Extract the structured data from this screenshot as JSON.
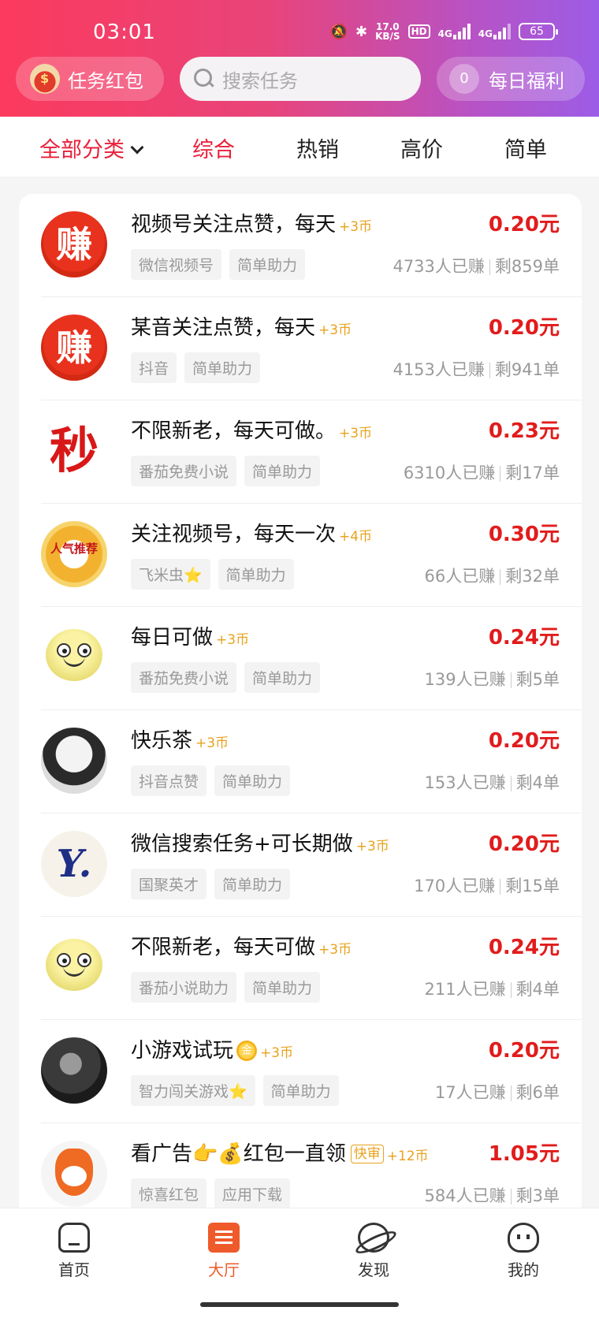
{
  "status_bar": {
    "time": "03:01",
    "net_speed_value": "17.0",
    "net_speed_unit": "KB/S",
    "hd_label": "HD",
    "sig1": "4G",
    "sig2": "4G",
    "battery": "65"
  },
  "header": {
    "redpack_label": "任务红包",
    "search_placeholder": "搜索任务",
    "daily_count": "0",
    "daily_label": "每日福利"
  },
  "filters": {
    "all_label": "全部分类",
    "tabs": [
      "综合",
      "热销",
      "高价",
      "简单"
    ],
    "active_tab": "综合"
  },
  "tasks": [
    {
      "avatar": "zhuan-icon",
      "avatar_text": "赚",
      "title": "视频号关注点赞，每天",
      "bonus": "+3币",
      "price": "0.20元",
      "tags": [
        "微信视频号",
        "简单助力"
      ],
      "earned": "4733人已赚",
      "left": "剩859单"
    },
    {
      "avatar": "zhuan-icon",
      "avatar_text": "赚",
      "title": "某音关注点赞，每天",
      "bonus": "+3币",
      "price": "0.20元",
      "tags": [
        "抖音",
        "简单助力"
      ],
      "earned": "4153人已赚",
      "left": "剩941单"
    },
    {
      "avatar": "miao-icon",
      "avatar_text": "秒",
      "title": "不限新老，每天可做。",
      "bonus": "+3币",
      "price": "0.23元",
      "tags": [
        "番茄免费小说",
        "简单助力"
      ],
      "earned": "6310人已赚",
      "left": "剩17单"
    },
    {
      "avatar": "popular-badge-icon",
      "avatar_text": "人气推荐",
      "title": "关注视频号，每天一次",
      "bonus": "+4币",
      "price": "0.30元",
      "tags": [
        "飞米虫⭐",
        "简单助力"
      ],
      "earned": "66人已赚",
      "left": "剩32单"
    },
    {
      "avatar": "smiley-icon",
      "avatar_text": "",
      "title": "每日可做",
      "bonus": "+3币",
      "price": "0.24元",
      "tags": [
        "番茄免费小说",
        "简单助力"
      ],
      "earned": "139人已赚",
      "left": "剩5单"
    },
    {
      "avatar": "girl-avatar",
      "avatar_text": "",
      "title": "快乐茶",
      "bonus": "+3币",
      "price": "0.20元",
      "tags": [
        "抖音点赞",
        "简单助力"
      ],
      "earned": "153人已赚",
      "left": "剩4单"
    },
    {
      "avatar": "y-logo-icon",
      "avatar_text": "Y.",
      "title": "微信搜索任务+可长期做",
      "bonus": "+3币",
      "price": "0.20元",
      "tags": [
        "国聚英才",
        "简单助力"
      ],
      "earned": "170人已赚",
      "left": "剩15单"
    },
    {
      "avatar": "smiley-icon",
      "avatar_text": "",
      "title": "不限新老，每天可做",
      "bonus": "+3币",
      "price": "0.24元",
      "tags": [
        "番茄小说助力",
        "简单助力"
      ],
      "earned": "211人已赚",
      "left": "剩4单"
    },
    {
      "avatar": "dark-avatar",
      "avatar_text": "",
      "title": "小游戏试玩",
      "gold": "金",
      "bonus": "+3币",
      "price": "0.20元",
      "tags": [
        "智力闯关游戏⭐",
        "简单助力"
      ],
      "earned": "17人已赚",
      "left": "剩6单"
    },
    {
      "avatar": "fox-icon",
      "avatar_text": "",
      "title": "看广告👉💰红包一直领",
      "kuai": "快审",
      "bonus": "+12币",
      "price": "1.05元",
      "tags": [
        "惊喜红包",
        "应用下载"
      ],
      "earned": "584人已赚",
      "left": "剩3单"
    }
  ],
  "bottom_nav": [
    {
      "label": "首页",
      "icon": "home-icon"
    },
    {
      "label": "大厅",
      "icon": "hall-icon",
      "active": true
    },
    {
      "label": "发现",
      "icon": "planet-icon"
    },
    {
      "label": "我的",
      "icon": "profile-icon"
    }
  ],
  "colors": {
    "accent": "#e8203a",
    "price": "#e11c1c",
    "bonus": "#e8a21e",
    "nav_active": "#ef5a2a"
  }
}
